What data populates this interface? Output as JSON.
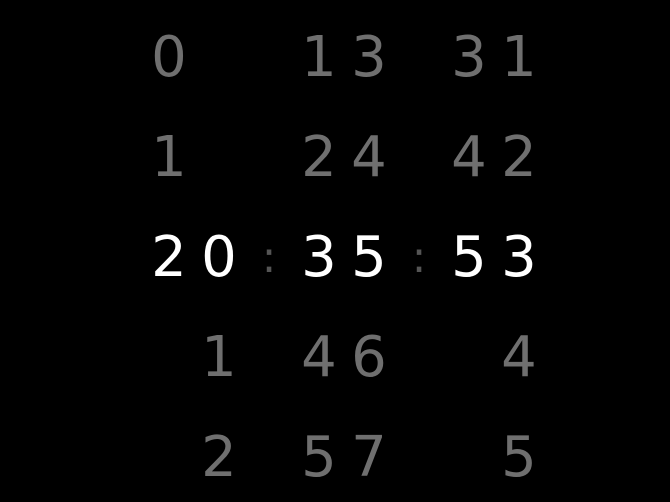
{
  "clock": {
    "current_time": "20:35:53",
    "separator": ":",
    "rows": [
      {
        "h1": "0",
        "h2": "",
        "m1": "1",
        "m2": "3",
        "s1": "3",
        "s2": "1"
      },
      {
        "h1": "1",
        "h2": "",
        "m1": "2",
        "m2": "4",
        "s1": "4",
        "s2": "2"
      },
      {
        "h1": "2",
        "h2": "0",
        "m1": "3",
        "m2": "5",
        "s1": "5",
        "s2": "3"
      },
      {
        "h1": "",
        "h2": "1",
        "m1": "4",
        "m2": "6",
        "s1": "",
        "s2": "4"
      },
      {
        "h1": "",
        "h2": "2",
        "m1": "5",
        "m2": "7",
        "s1": "",
        "s2": "5"
      }
    ]
  },
  "colors": {
    "background": "#000000",
    "active_digit": "#ffffff",
    "inactive_digit": "#6f6f6f",
    "separator": "#555555"
  }
}
